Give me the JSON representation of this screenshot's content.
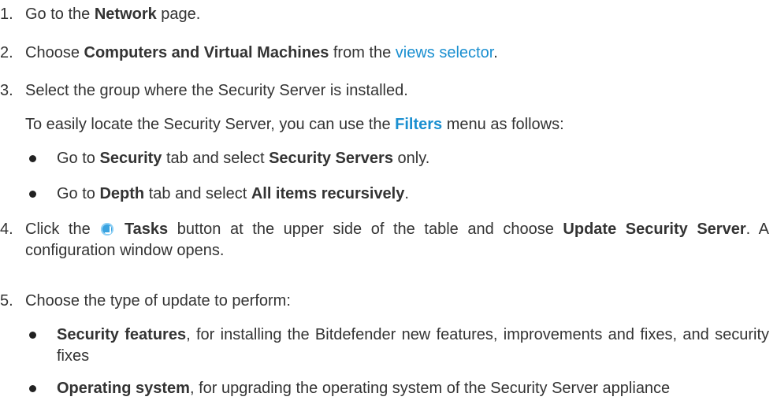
{
  "steps": [
    {
      "num": "1.",
      "pre": "Go to the ",
      "bold": "Network",
      "post": " page."
    },
    {
      "num": "2.",
      "pre": "Choose ",
      "bold": "Computers and Virtual Machines",
      "mid": " from the ",
      "link": "views selector",
      "post": "."
    },
    {
      "num": "3.",
      "text": "Select the group where the Security Server is installed."
    },
    {
      "pre": "To easily locate the Security Server, you can use the ",
      "link_bold": "Filters",
      "post": " menu as follows:"
    },
    {
      "pre": "Go to ",
      "bold1": "Security",
      "mid": " tab and select ",
      "bold2": "Security Servers",
      "post": " only."
    },
    {
      "pre": "Go to ",
      "bold1": "Depth",
      "mid": " tab and select ",
      "bold2": "All items recursively",
      "post": "."
    },
    {
      "num": "4.",
      "pre": "Click the ",
      "bold1": "Tasks",
      "mid": " button at the upper side of the table and choose ",
      "bold2": "Update Security Server",
      "post": ". A configuration window opens."
    },
    {
      "num": "5.",
      "text": "Choose the type of update to perform:"
    },
    {
      "bold": "Security features",
      "post": ", for installing the Bitdefender new features, improvements and fixes, and security fixes"
    },
    {
      "bold": "Operating system",
      "post": ", for upgrading the operating system of the Security Server appliance"
    }
  ],
  "icons": {
    "tasks": "tasks-icon"
  },
  "colors": {
    "link": "#1a8fd0",
    "text": "#333333"
  }
}
